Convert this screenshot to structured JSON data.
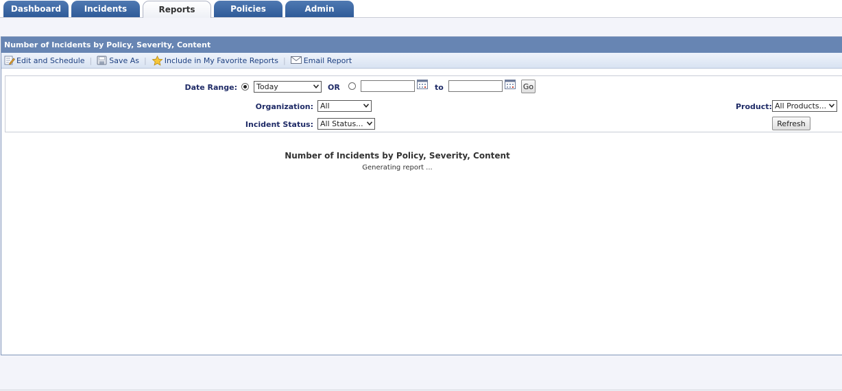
{
  "tabs": [
    {
      "label": "Dashboard",
      "active": false
    },
    {
      "label": "Incidents",
      "active": false
    },
    {
      "label": "Reports",
      "active": true
    },
    {
      "label": "Policies",
      "active": false
    },
    {
      "label": "Admin",
      "active": false
    }
  ],
  "panel": {
    "title": "Number of Incidents by Policy, Severity, Content"
  },
  "toolbar": {
    "edit_schedule": "Edit and Schedule",
    "save_as": "Save As",
    "favorite": "Include in My Favorite Reports",
    "email": "Email Report"
  },
  "filters": {
    "date_range_label": "Date Range:",
    "date_range_value": "Today",
    "or_label": "OR",
    "to_label": "to",
    "from_value": "",
    "to_value": "",
    "go_label": "Go",
    "organization_label": "Organization:",
    "organization_value": "All",
    "incident_status_label": "Incident Status:",
    "incident_status_value": "All Status...",
    "product_label": "Product:",
    "product_value": "All Products...",
    "refresh_label": "Refresh"
  },
  "report": {
    "title": "Number of Incidents by Policy, Severity, Content",
    "status": "Generating report ..."
  },
  "colors": {
    "tab_blue": "#2f5b98",
    "header_blue": "#6785b3",
    "label_navy": "#1e2a66"
  }
}
